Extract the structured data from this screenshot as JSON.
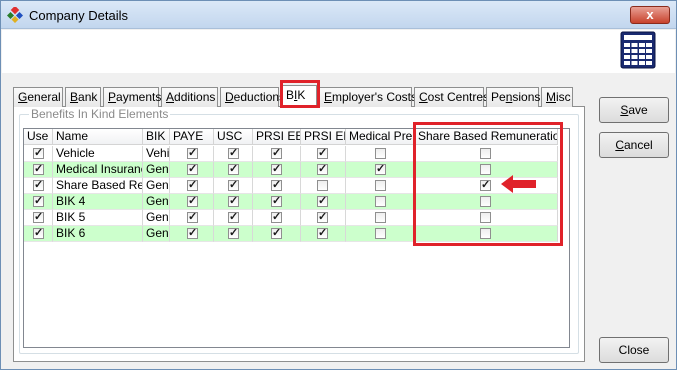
{
  "window": {
    "title": "Company Details",
    "close_glyph": "x"
  },
  "tabs": [
    {
      "label": "General",
      "accel": "G"
    },
    {
      "label": "Bank",
      "accel": "B"
    },
    {
      "label": "Payments",
      "accel": "P"
    },
    {
      "label": "Additions",
      "accel": "A"
    },
    {
      "label": "Deductions",
      "accel": "D"
    },
    {
      "label": "BIK",
      "accel": "I"
    },
    {
      "label": "Employer's Costs",
      "accel": "E"
    },
    {
      "label": "Cost Centres",
      "accel": "C"
    },
    {
      "label": "Pensions",
      "accel": "n"
    },
    {
      "label": "Misc",
      "accel": "M"
    }
  ],
  "active_tab": "BIK",
  "group": {
    "label": "Benefits In Kind Elements"
  },
  "grid": {
    "columns": [
      "Use",
      "Name",
      "BIK",
      "PAYE",
      "USC",
      "PRSI EE",
      "PRSI ER",
      "Medical Prem",
      "Share Based Remuneration"
    ],
    "rows": [
      {
        "use": true,
        "name": "Vehicle",
        "bik": "Vehi",
        "paye": true,
        "usc": true,
        "prsi_ee": true,
        "prsi_er": true,
        "medical": false,
        "share": false,
        "color": "white"
      },
      {
        "use": true,
        "name": "Medical Insurance",
        "bik": "Gene",
        "paye": true,
        "usc": true,
        "prsi_ee": true,
        "prsi_er": true,
        "medical": true,
        "share": false,
        "color": "green"
      },
      {
        "use": true,
        "name": "Share Based Rem",
        "bik": "Gene",
        "paye": true,
        "usc": true,
        "prsi_ee": true,
        "prsi_er": false,
        "medical": false,
        "share": true,
        "color": "white"
      },
      {
        "use": true,
        "name": "BIK 4",
        "bik": "Gene",
        "paye": true,
        "usc": true,
        "prsi_ee": true,
        "prsi_er": true,
        "medical": false,
        "share": false,
        "color": "green"
      },
      {
        "use": true,
        "name": "BIK 5",
        "bik": "Gene",
        "paye": true,
        "usc": true,
        "prsi_ee": true,
        "prsi_er": true,
        "medical": false,
        "share": false,
        "color": "white"
      },
      {
        "use": true,
        "name": "BIK 6",
        "bik": "Gene",
        "paye": true,
        "usc": true,
        "prsi_ee": true,
        "prsi_er": true,
        "medical": false,
        "share": false,
        "color": "green"
      }
    ]
  },
  "buttons": {
    "save": {
      "label": "Save",
      "accel": "S"
    },
    "cancel": {
      "label": "Cancel",
      "accel": "C"
    },
    "close": {
      "label": "Close"
    }
  },
  "colors": {
    "highlight": "#e0222a",
    "row_green": "#ccffcc"
  },
  "icons": {
    "app": "app-diamond-icon",
    "header": "calculator-grid-icon",
    "annotation": "red-arrow-icon"
  }
}
